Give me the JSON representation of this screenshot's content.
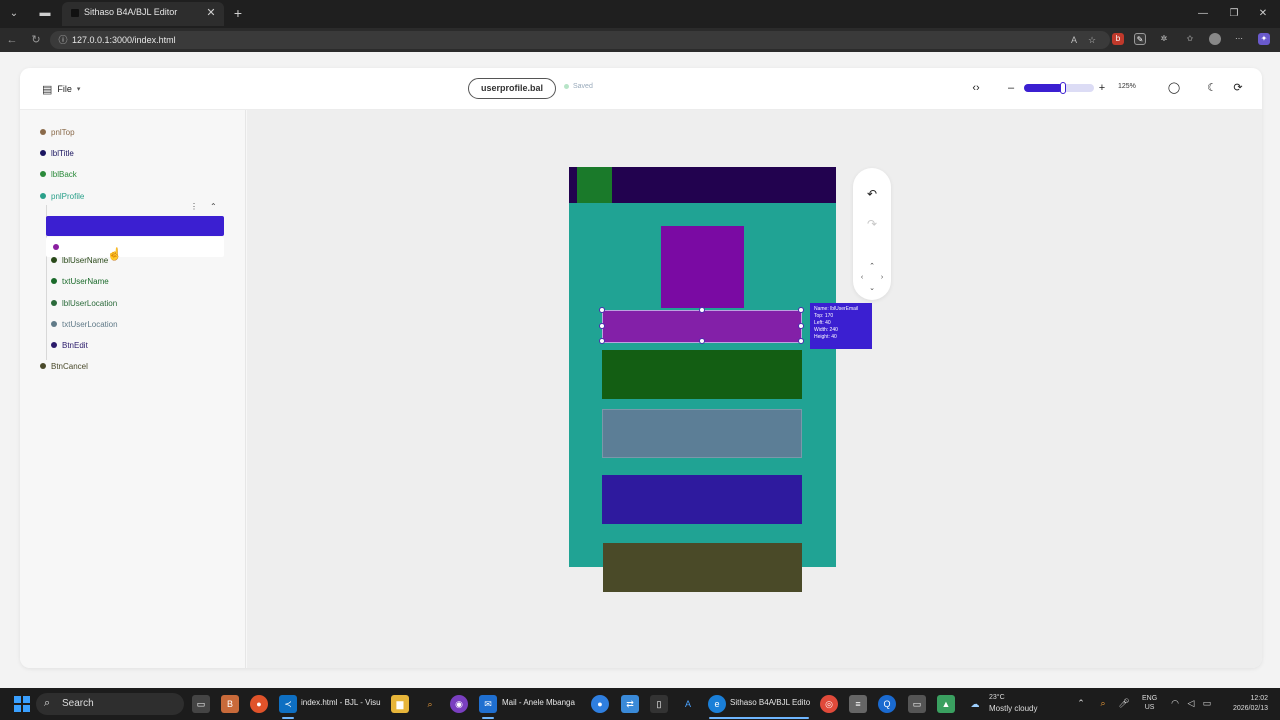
{
  "browser": {
    "tab_title": "Sithaso B4A/BJL Editor",
    "url": "127.0.0.1:3000/index.html"
  },
  "toolbar": {
    "file_label": "File",
    "filename": "userprofile.bal",
    "status": "Saved",
    "zoom_level": "125%",
    "zoom_fraction": 0.55
  },
  "tree": {
    "items": [
      {
        "label": "pnlTop",
        "color": "#8a6a4a"
      },
      {
        "label": "lblTitle",
        "color": "#1a1560"
      },
      {
        "label": "lblBack",
        "color": "#2a8a3a"
      },
      {
        "label": "pnlProfile",
        "color": "#2aa08a"
      },
      {
        "label": "",
        "color": "#3b1fd1"
      },
      {
        "label": "",
        "color": "#8a1fa0"
      },
      {
        "label": "lblUserName",
        "color": "#2a4a1a"
      },
      {
        "label": "txtUserName",
        "color": "#1a6a2a"
      },
      {
        "label": "lblUserLocation",
        "color": "#2a6a3a"
      },
      {
        "label": "txtUserLocation",
        "color": "#607a88"
      },
      {
        "label": "BtnEdit",
        "color": "#2a1a6a"
      },
      {
        "label": "BtnCancel",
        "color": "#4a4a2a"
      }
    ]
  },
  "canvas": {
    "colors": {
      "panel": "#20a394",
      "header": "#22024f",
      "back": "#1a7a2a",
      "avatar": "#7a0aa3",
      "email": "#8320a8",
      "username": "#135e13",
      "location": "#5c7e96",
      "edit": "#2e1a9e",
      "cancel": "#4a4a28"
    },
    "tooltip": {
      "name": "Name: lblUserEmail",
      "top": "Top: 170",
      "left": "Left: 40",
      "width": "Width: 240",
      "height": "Height: 40"
    }
  },
  "taskbar": {
    "search": "Search",
    "vscode_label": "index.html - BJL - Visu",
    "mail_label": "Mail - Anele Mbanga",
    "edge_label": "Sithaso B4A/BJL Edito",
    "weather_temp": "23°C",
    "weather_desc": "Mostly cloudy",
    "lang_1": "ENG",
    "lang_2": "US",
    "time": "12:02",
    "date": "2026/02/13"
  }
}
